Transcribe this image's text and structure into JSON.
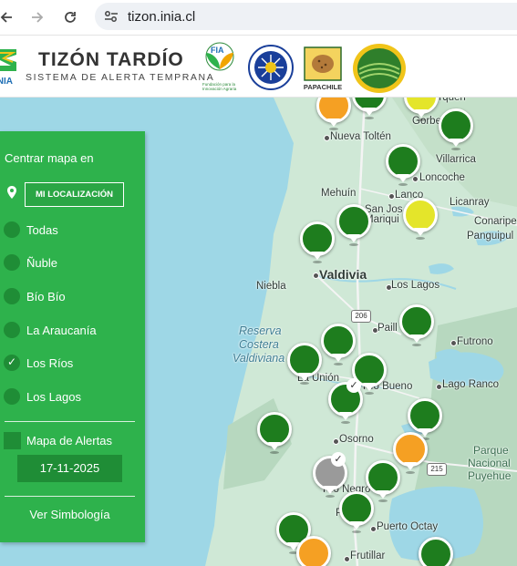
{
  "browser": {
    "url": "tizon.inia.cl"
  },
  "header": {
    "inia_label": "INIA",
    "title": "TIZÓN TARDÍO",
    "subtitle": "SISTEMA DE ALERTA TEMPRANA",
    "fia_caption": "Fundación para la Innovación Agraria",
    "papachile_label": "PAPACHILE"
  },
  "sidebar": {
    "center_label": "Centrar mapa en",
    "location_button": "MI LOCALIZACIÓN",
    "regions": [
      {
        "label": "Todas",
        "checked": false
      },
      {
        "label": "Ñuble",
        "checked": false
      },
      {
        "label": "Bío Bío",
        "checked": false
      },
      {
        "label": "La Araucanía",
        "checked": false
      },
      {
        "label": "Los Ríos",
        "checked": true
      },
      {
        "label": "Los Lagos",
        "checked": false
      }
    ],
    "alert_map_label": "Mapa de Alertas",
    "date": "17-11-2025",
    "symbology_link": "Ver Simbología"
  },
  "map": {
    "places": {
      "purquen": "urquen",
      "gorbea": "Gorbe",
      "nueva_tolten": "Nueva Toltén",
      "villarrica": "Villarrica",
      "loncoche": "Loncoche",
      "mehuin": "Mehuín",
      "lanco": "Lanco",
      "licanray": "Licanray",
      "conaripe": "Conaripe",
      "san_jose": "San Jos",
      "mariquina": "Mariqui",
      "panguipulli": "Panguipul",
      "valdivia": "Valdivia",
      "niebla": "Niebla",
      "los_lagos": "Los Lagos",
      "paillaco": "Paill",
      "futrono": "Futrono",
      "reserva_1": "Reserva",
      "reserva_2": "Costera",
      "reserva_3": "Valdiviana",
      "la_union": "La Unión",
      "rio_bueno": "Río Bueno",
      "lago_ranco": "Lago Ranco",
      "osorno": "Osorno",
      "parque_1": "Parque",
      "parque_2": "Nacional",
      "parque_3": "Puyehue",
      "rio_negro": "Río Negro",
      "purranque": "P",
      "puerto_octay": "Puerto Octay",
      "frutillar": "Frutillar",
      "route_206": "206",
      "route_215": "215"
    },
    "marker_colors": {
      "green": "#1e7d1e",
      "orange": "#f5a023",
      "yellow": "#e4e52a",
      "gray": "#9a9a9a"
    }
  },
  "colors": {
    "sidebar_green": "#2eb24c",
    "sidebar_dark_green": "#1f8d36",
    "water": "#9ed7e6",
    "land": "#cfe8d6"
  }
}
